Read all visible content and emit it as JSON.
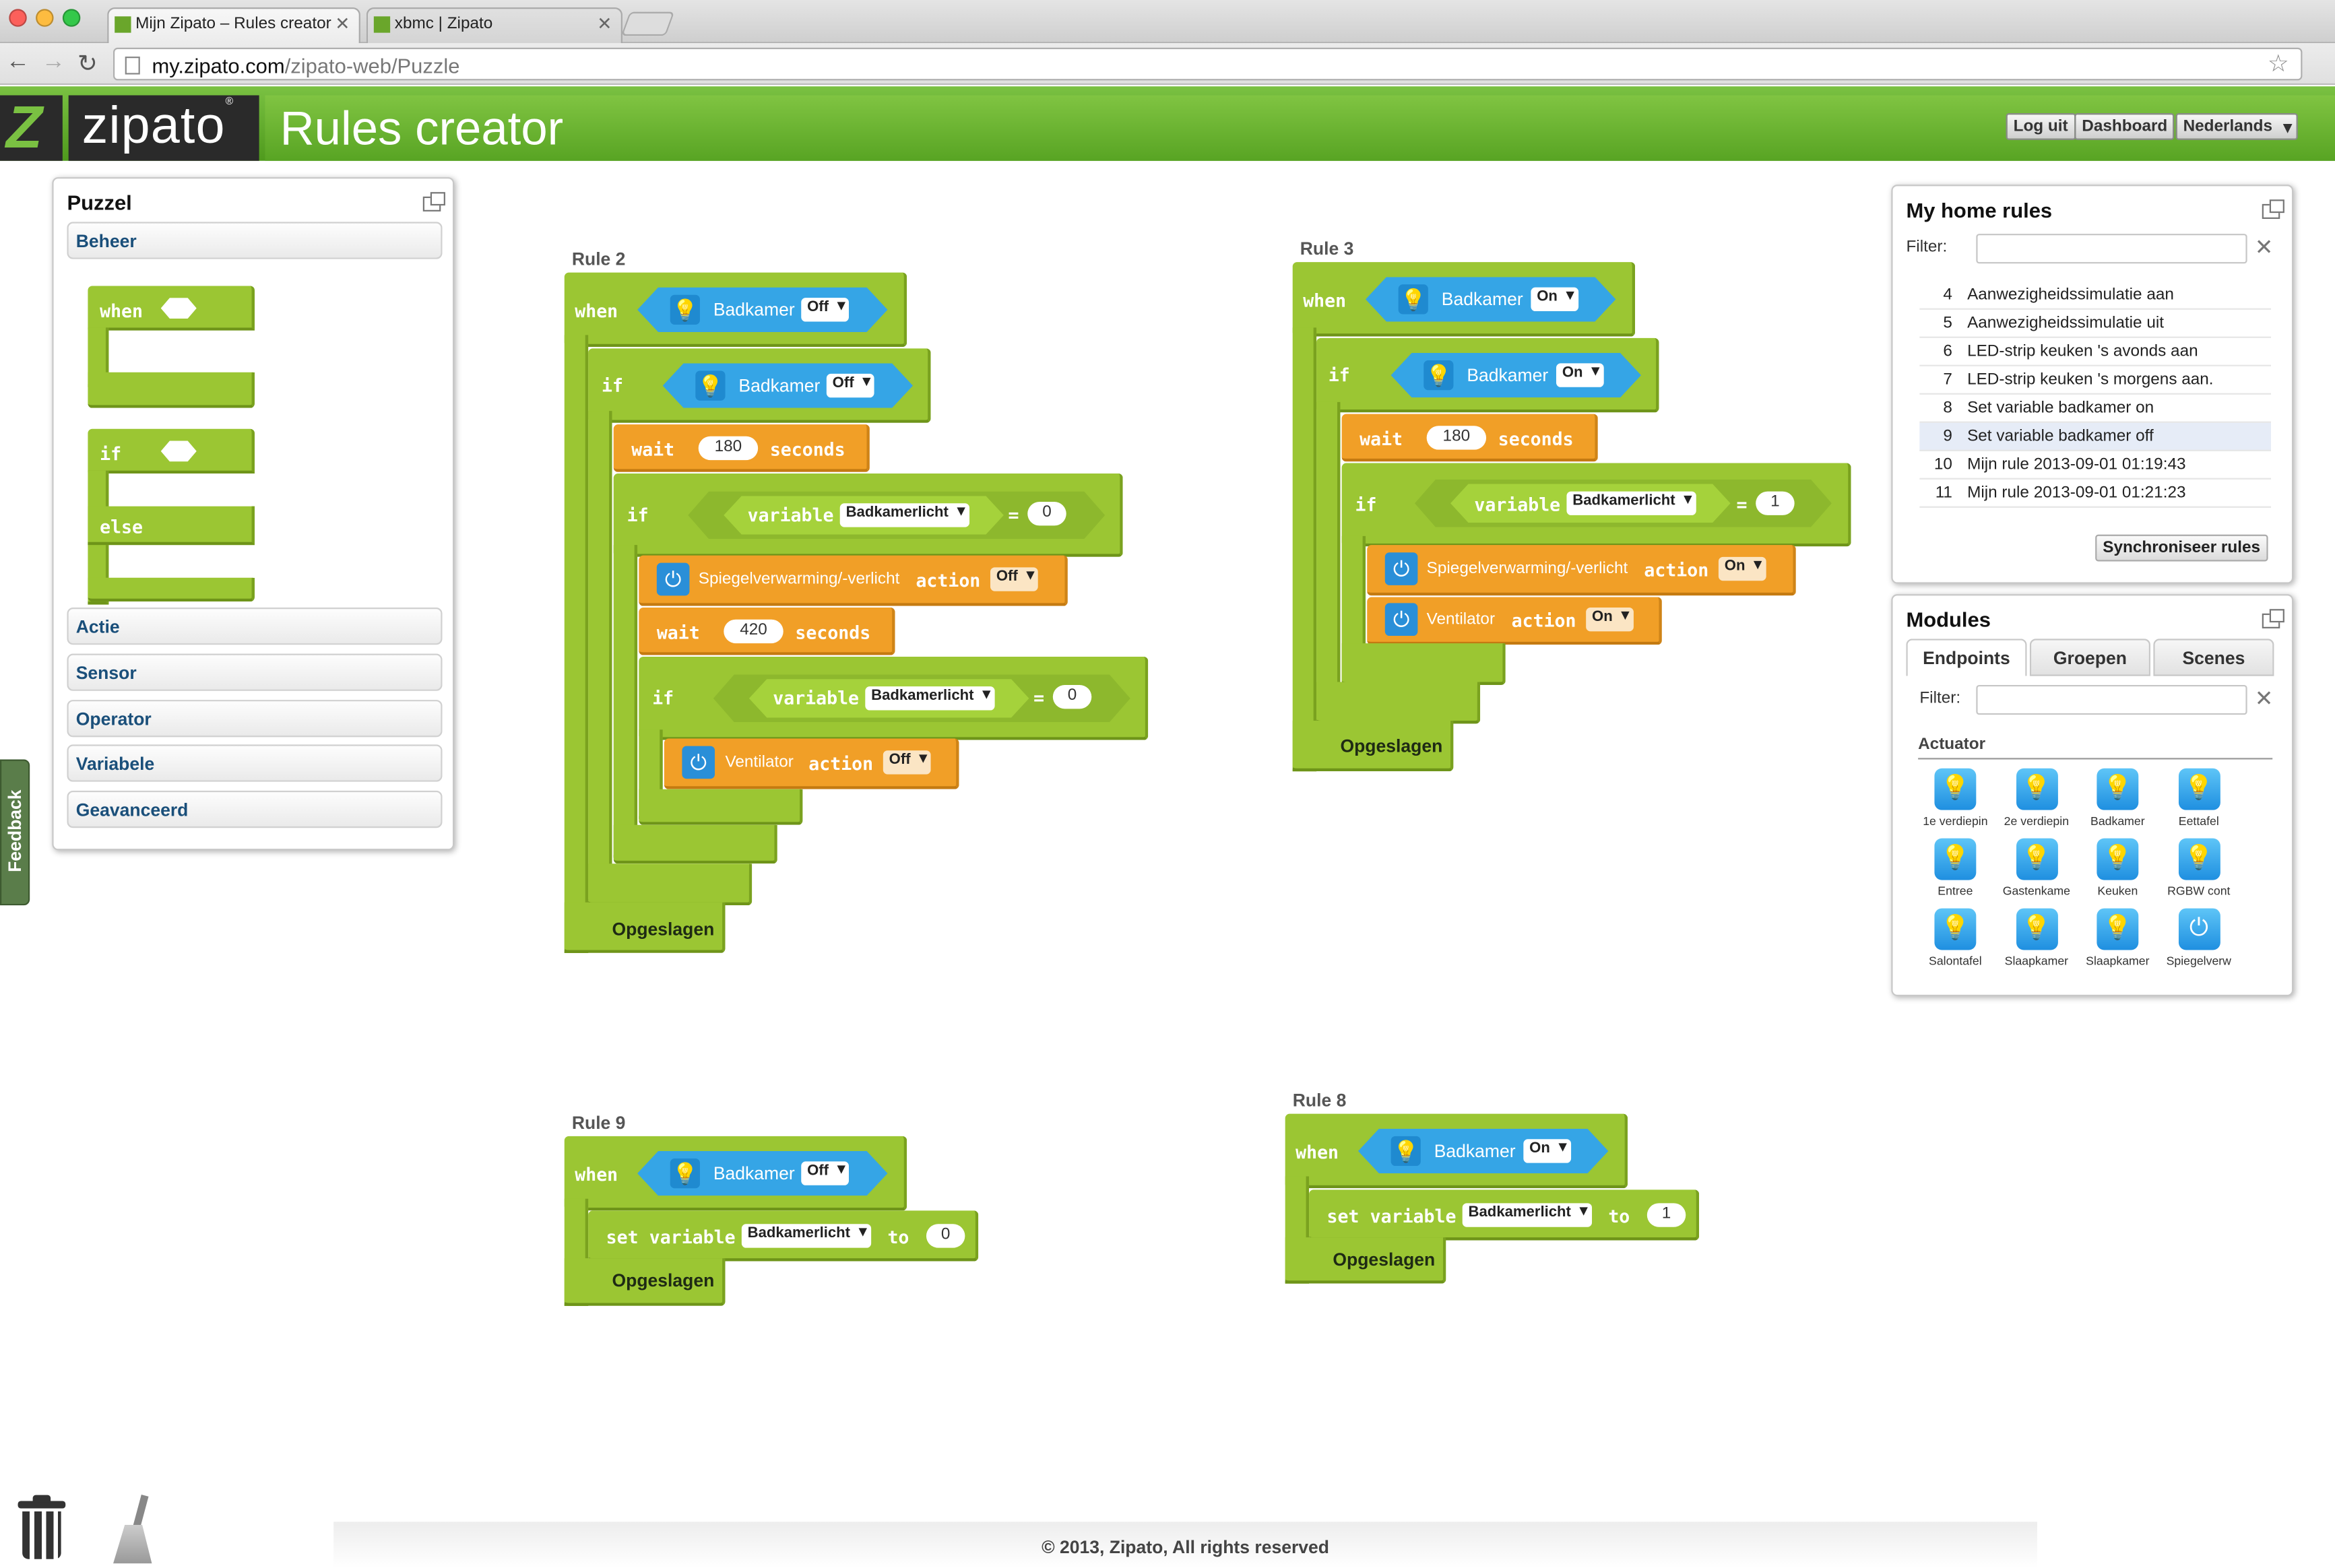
{
  "browser": {
    "tabs": [
      {
        "title": "Mijn Zipato – Rules creator"
      },
      {
        "title": "xbmc | Zipato"
      }
    ],
    "url_host": "my.zipato.com",
    "url_path": "/zipato-web/Puzzle"
  },
  "header": {
    "logo": "zipato",
    "title": "Rules creator",
    "buttons": [
      "Log uit",
      "Dashboard",
      "Nederlands"
    ]
  },
  "puzzle": {
    "title": "Puzzel",
    "categories": [
      "Beheer",
      "Actie",
      "Sensor",
      "Operator",
      "Variabele",
      "Geavanceerd"
    ],
    "palette": {
      "when": "when",
      "if": "if",
      "else": "else"
    }
  },
  "feedback": "Feedback",
  "rules": {
    "rule2": {
      "label": "Rule 2",
      "when": "when",
      "device": "Badkamer",
      "state": "Off",
      "if1": "if",
      "if1_device": "Badkamer",
      "if1_state": "Off",
      "wait": "wait",
      "wait1": "180",
      "seconds": "seconds",
      "if2": "if",
      "variable": "variable",
      "var_name": "Badkamerlicht",
      "eq": "=",
      "var_val": "0",
      "action_device": "Spiegelverwarming/-verlicht",
      "action": "action",
      "action_state": "Off",
      "wait2": "420",
      "if3": "if",
      "var_val3": "0",
      "vent_device": "Ventilator",
      "vent_state": "Off",
      "saved": "Opgeslagen"
    },
    "rule3": {
      "label": "Rule 3",
      "when": "when",
      "device": "Badkamer",
      "state": "On",
      "if1": "if",
      "if1_device": "Badkamer",
      "if1_state": "On",
      "wait": "wait",
      "wait1": "180",
      "seconds": "seconds",
      "if2": "if",
      "variable": "variable",
      "var_name": "Badkamerlicht",
      "eq": "=",
      "var_val": "1",
      "action_device": "Spiegelverwarming/-verlicht",
      "action": "action",
      "action_state": "On",
      "vent_device": "Ventilator",
      "vent_state": "On",
      "saved": "Opgeslagen"
    },
    "rule9": {
      "label": "Rule 9",
      "when": "when",
      "device": "Badkamer",
      "state": "Off",
      "set": "set",
      "variable": "variable",
      "var_name": "Badkamerlicht",
      "to": "to",
      "value": "0",
      "saved": "Opgeslagen"
    },
    "rule8": {
      "label": "Rule 8",
      "when": "when",
      "device": "Badkamer",
      "state": "On",
      "set": "set",
      "variable": "variable",
      "var_name": "Badkamerlicht",
      "to": "to",
      "value": "1",
      "saved": "Opgeslagen"
    }
  },
  "home_rules": {
    "title": "My home rules",
    "filter_label": "Filter:",
    "items": [
      {
        "n": "4",
        "name": "Aanwezigheidssimulatie aan"
      },
      {
        "n": "5",
        "name": "Aanwezigheidssimulatie uit"
      },
      {
        "n": "6",
        "name": "LED-strip keuken 's avonds aan"
      },
      {
        "n": "7",
        "name": "LED-strip keuken 's morgens aan."
      },
      {
        "n": "8",
        "name": "Set variable badkamer on"
      },
      {
        "n": "9",
        "name": "Set variable badkamer off"
      },
      {
        "n": "10",
        "name": "Mijn rule 2013-09-01 01:19:43"
      },
      {
        "n": "11",
        "name": "Mijn rule 2013-09-01 01:21:23"
      }
    ],
    "selected_index": 5,
    "sync_button": "Synchroniseer rules"
  },
  "modules": {
    "title": "Modules",
    "tabs": [
      "Endpoints",
      "Groepen",
      "Scenes"
    ],
    "filter_label": "Filter:",
    "section": "Actuator",
    "devices": [
      {
        "label": "1e verdiepin",
        "icon": "bulb-icon"
      },
      {
        "label": "2e verdiepin",
        "icon": "bulb-icon"
      },
      {
        "label": "Badkamer",
        "icon": "bulb-icon"
      },
      {
        "label": "Eettafel",
        "icon": "bulb-icon"
      },
      {
        "label": "Entree",
        "icon": "bulb-icon"
      },
      {
        "label": "Gastenkame",
        "icon": "bulb-icon"
      },
      {
        "label": "Keuken",
        "icon": "bulb-icon"
      },
      {
        "label": "RGBW cont",
        "icon": "bulb-icon"
      },
      {
        "label": "Salontafel",
        "icon": "bulb-icon"
      },
      {
        "label": "Slaapkamer",
        "icon": "bulb-icon"
      },
      {
        "label": "Slaapkamer",
        "icon": "bulb-icon"
      },
      {
        "label": "Spiegelverw",
        "icon": "power-icon"
      }
    ]
  },
  "footer": "© 2013, Zipato, All rights reserved",
  "colors": {
    "brand_green": "#7ac142",
    "block_green": "#9bc633",
    "block_orange": "#f19f27",
    "block_blue": "#35a5e6"
  }
}
